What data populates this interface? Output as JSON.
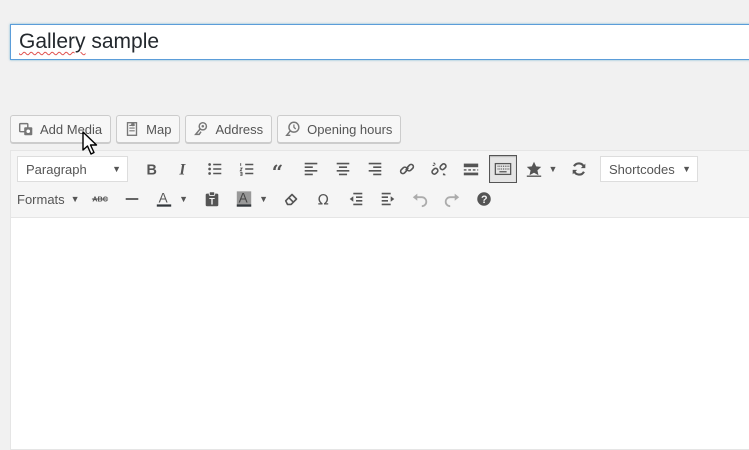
{
  "post": {
    "title": "Gallery sample"
  },
  "media_buttons": [
    {
      "label": "Add Media",
      "icon": "add-media-icon"
    },
    {
      "label": "Map",
      "icon": "map-icon"
    },
    {
      "label": "Address",
      "icon": "address-icon"
    },
    {
      "label": "Opening hours",
      "icon": "opening-hours-icon"
    }
  ],
  "toolbar": {
    "format_select": "Paragraph",
    "shortcodes_select": "Shortcodes",
    "formats_menu": "Formats",
    "strikethrough_label": "ABC",
    "text_color_glyph": "A",
    "background_color_glyph": "A",
    "special_char_glyph": "Ω",
    "help_glyph": "?",
    "blockquote_glyph": "“"
  }
}
